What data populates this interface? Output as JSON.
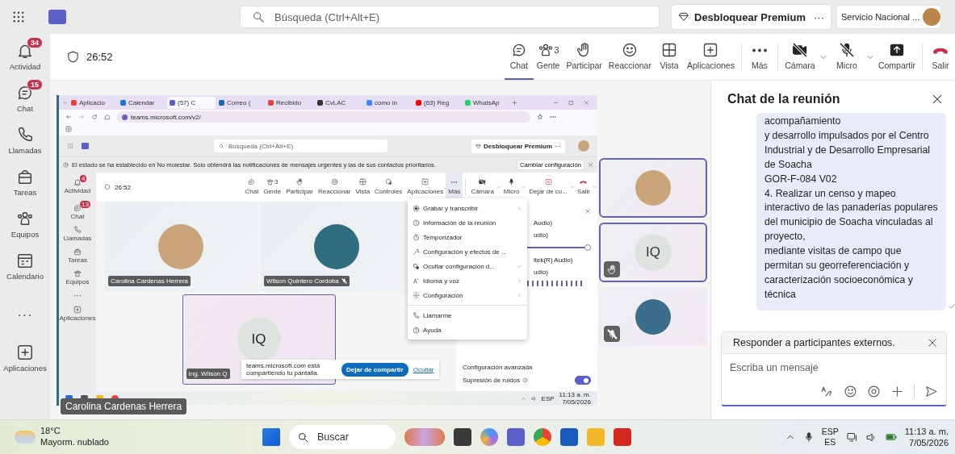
{
  "top_bar": {
    "search": {
      "placeholder": "Búsqueda (Ctrl+Alt+E)"
    },
    "premium_button": "Desbloquear Premium",
    "more_button": "···",
    "account_name": "Servicio Nacional ..."
  },
  "rail": [
    {
      "kind": "bell",
      "label": "Actividad",
      "badge": "34"
    },
    {
      "kind": "chat",
      "label": "Chat",
      "badge": "15"
    },
    {
      "kind": "phone",
      "label": "Llamadas"
    },
    {
      "kind": "bag",
      "label": "Tareas"
    },
    {
      "kind": "people",
      "label": "Equipos"
    },
    {
      "kind": "calendar",
      "label": "Calendario"
    },
    {
      "kind": "more",
      "label": "···"
    },
    {
      "kind": "apps",
      "label": "Aplicaciones"
    }
  ],
  "meeting_bar": {
    "timer": "26:52",
    "actions": [
      {
        "kind": "chat",
        "label": "Chat",
        "selected": true
      },
      {
        "kind": "people",
        "label": "Gente",
        "count": "3",
        "selected": false
      },
      {
        "kind": "hand",
        "label": "Participar",
        "selected": false
      },
      {
        "kind": "smile",
        "label": "Reaccionar",
        "selected": false
      },
      {
        "kind": "layout",
        "label": "Vista",
        "selected": false
      },
      {
        "kind": "apps",
        "label": "Aplicaciones",
        "selected": false
      },
      {
        "kind": "more",
        "label": "Más",
        "selected": false
      }
    ],
    "controls": [
      {
        "kind": "camera",
        "label": "Cámara",
        "off": true
      },
      {
        "kind": "mic",
        "label": "Micro",
        "off": true
      },
      {
        "kind": "share",
        "label": "Compartir"
      },
      {
        "kind": "leave",
        "label": "Salir"
      }
    ]
  },
  "shared_screen": {
    "browser_tabs": [
      {
        "label": "Aplicacio",
        "selected": false
      },
      {
        "label": "Calendar",
        "selected": false
      },
      {
        "label": "(57) C",
        "selected": true
      },
      {
        "label": "Correo (",
        "selected": false
      },
      {
        "label": "Recibido",
        "selected": false
      },
      {
        "label": "CvLAC",
        "selected": false
      },
      {
        "label": "como in",
        "selected": false
      },
      {
        "label": "(63) Reg",
        "selected": false
      },
      {
        "label": "WhatsAp",
        "selected": false
      }
    ],
    "url": "teams.microsoft.com/v2/",
    "teams_search": {
      "placeholder": "Búsqueda (Ctrl+Alt+E)"
    },
    "premium_button": "Desbloquear Premium",
    "more_button": "···",
    "notice": "El estado se ha establecido en No molestar. Solo obtendrá las notificaciones de mensajes urgentes y las de sus contactos prioritarios.",
    "notice_button": "Cambiar configuración",
    "rail": [
      {
        "kind": "bell",
        "label": "Actividad",
        "badge": "4"
      },
      {
        "kind": "chat",
        "label": "Chat",
        "badge": "13"
      },
      {
        "kind": "phone",
        "label": "Llamadas"
      },
      {
        "kind": "bag",
        "label": "Tareas"
      },
      {
        "kind": "people",
        "label": "Equipos"
      },
      {
        "kind": "more",
        "label": "···"
      },
      {
        "kind": "apps",
        "label": "Aplicaciones"
      }
    ],
    "timer": "26:52",
    "actions": [
      {
        "kind": "chat",
        "label": "Chat",
        "selected": false
      },
      {
        "kind": "people",
        "label": "Gente",
        "count": "3",
        "selected": false
      },
      {
        "kind": "hand",
        "label": "Participar",
        "selected": false
      },
      {
        "kind": "smile",
        "label": "Reaccionar",
        "selected": false
      },
      {
        "kind": "layout",
        "label": "Vista",
        "selected": false
      },
      {
        "kind": "controls",
        "label": "Controles",
        "selected": false
      },
      {
        "kind": "apps",
        "label": "Aplicaciones",
        "selected": false
      },
      {
        "kind": "more",
        "label": "Más",
        "selected": true
      }
    ],
    "controls": [
      {
        "kind": "camera",
        "label": "Cámara",
        "off": true
      },
      {
        "kind": "mic",
        "label": "Micro",
        "off": false
      },
      {
        "kind": "stopshare",
        "label": "Dejar de co..."
      },
      {
        "kind": "leave",
        "label": "Salir"
      }
    ],
    "tiles": [
      {
        "kind": "photo",
        "name": "Carolina Cardenas Herrera",
        "muted": false,
        "highlighted": false
      },
      {
        "kind": "photo",
        "name": "Wilson Quintero Cordoba",
        "muted": true,
        "highlighted": false
      },
      {
        "kind": "initials",
        "initials": "IQ",
        "name": "Ing. Wilson Q",
        "muted": false,
        "highlighted": true
      }
    ],
    "menu": [
      [
        {
          "kind": "record",
          "label": "Grabar y transcribir",
          "submenu": true,
          "checked": false
        },
        {
          "kind": "info",
          "label": "Información de la reunión",
          "submenu": false,
          "checked": false
        },
        {
          "kind": "timer",
          "label": "Temporizador",
          "submenu": false,
          "checked": false
        },
        {
          "kind": "effects",
          "label": "Configuración y efectos de ...",
          "submenu": false,
          "checked": false
        },
        {
          "kind": "hide",
          "label": "Ocultar configuración d...",
          "submenu": false,
          "checked": true
        },
        {
          "kind": "language",
          "label": "Idioma y voz",
          "submenu": true,
          "checked": false
        },
        {
          "kind": "gear",
          "label": "Configuración",
          "submenu": true,
          "checked": false
        }
      ],
      [
        {
          "kind": "phone",
          "label": "Llamarme",
          "submenu": false,
          "checked": false
        },
        {
          "kind": "help",
          "label": "Ayuda",
          "submenu": false,
          "checked": false
        }
      ]
    ],
    "panel_texts": [
      "Audio)",
      "udio)",
      "ltek(R) Audio)",
      "udio)"
    ],
    "volume": {
      "level": 0.95
    },
    "advanced": "Configuración avanzada",
    "noise_label": "Supresión de ruidos",
    "noise_toggle": {
      "on": true
    },
    "share_bar": {
      "text": "teams.microsoft.com está compartiendo tu pantalla.",
      "stop_button": "Dejar de compartir",
      "hide_link": "Ocultar"
    },
    "taskbar": {
      "language": "ESP",
      "time": "11:13 a. m.",
      "date": "7/05/2026"
    }
  },
  "presenter_label": "Carolina Cardenas Herrera",
  "thumbnails": [
    {
      "kind": "photo",
      "highlighted": true,
      "hand_raised": false,
      "muted": false
    },
    {
      "kind": "initials",
      "initials": "IQ",
      "highlighted": true,
      "hand_raised": true,
      "muted": false
    },
    {
      "kind": "photo",
      "highlighted": false,
      "hand_raised": false,
      "muted": true
    }
  ],
  "chat": {
    "title": "Chat de la reunión",
    "message": "acompañamiento\ny desarrollo impulsados por el Centro\nIndustrial y de Desarrollo Empresarial\nde Soacha\nGOR-F-084 V02\n4. Realizar un censo y mapeo\ninteractivo de las panaderías populares\ndel municipio de Soacha vinculadas al\nproyecto,\nmediante visitas de campo que\npermitan su georreferenciación y\ncaracterización socioeconómica y\ntécnica",
    "reply_banner": "Responder a participantes externos.",
    "composer": {
      "placeholder": "Escriba un mensaje"
    }
  },
  "taskbar": {
    "temperature": "18°C",
    "weather": "Mayorm. nublado",
    "search": {
      "placeholder": "Buscar"
    },
    "language": "ESP",
    "layout": "ES",
    "time": "11:13 a. m.",
    "date": "7/05/2026"
  }
}
